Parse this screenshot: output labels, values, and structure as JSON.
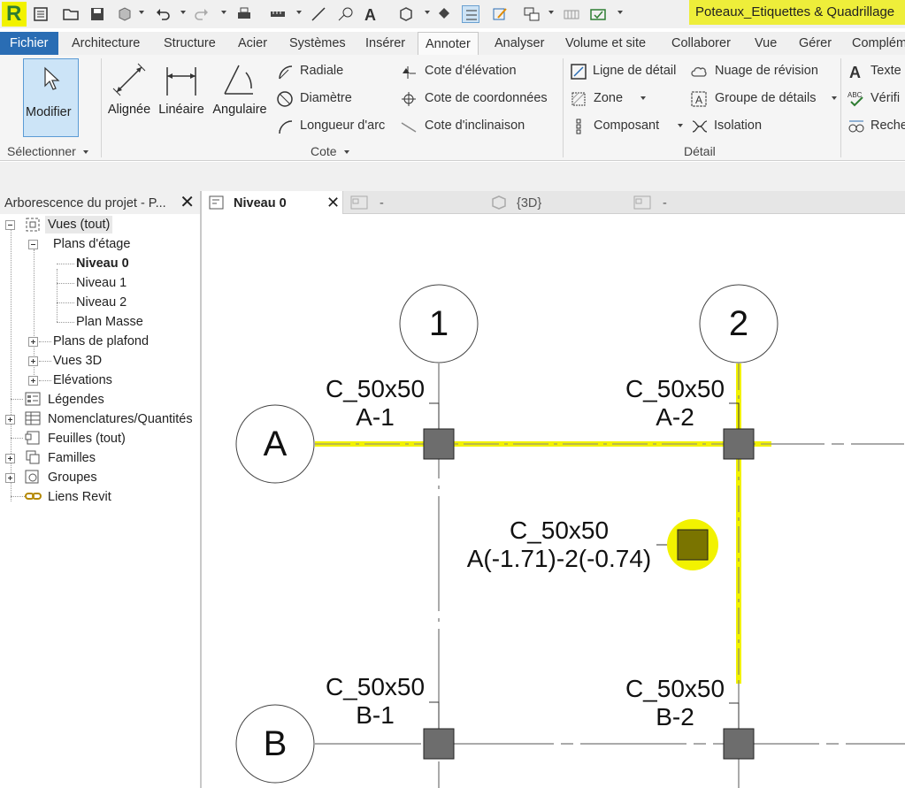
{
  "app": {
    "logo_letter": "R",
    "document_title": "Poteaux_Etiquettes & Quadrillage",
    "highlight_color": "#eeee3a"
  },
  "menu": {
    "file": "Fichier",
    "tabs": [
      "Architecture",
      "Structure",
      "Acier",
      "Systèmes",
      "Insérer",
      "Annoter",
      "Analyser",
      "Volume et site",
      "Collaborer",
      "Vue",
      "Gérer",
      "Complém"
    ],
    "active_tab": "Annoter"
  },
  "ribbon": {
    "select": {
      "modifier": "Modifier",
      "panel": "Sélectionner"
    },
    "cote": {
      "panel": "Cote",
      "big": [
        "Alignée",
        "Linéaire",
        "Angulaire"
      ],
      "col1": [
        "Radiale",
        "Diamètre",
        "Longueur d'arc"
      ],
      "col2": [
        "Cote d'élévation",
        "Cote de coordonnées",
        "Cote d'inclinaison"
      ]
    },
    "detail": {
      "panel": "Détail",
      "col1": [
        "Ligne de détail",
        "Zone",
        "Composant"
      ],
      "col2": [
        "Nuage de révision",
        "Groupe de détails",
        "Isolation"
      ]
    },
    "texte": {
      "items": [
        "Texte",
        "Vérifi",
        "Reche"
      ]
    }
  },
  "browser": {
    "title": "Arborescence du projet - P...",
    "items": {
      "vues": "Vues (tout)",
      "plans": "Plans d'étage",
      "niveau0": "Niveau 0",
      "niveau1": "Niveau 1",
      "niveau2": "Niveau 2",
      "planmasse": "Plan Masse",
      "plafond": "Plans de plafond",
      "vues3d": "Vues 3D",
      "elevations": "Elévations",
      "legendes": "Légendes",
      "nomenclatures": "Nomenclatures/Quantités",
      "feuilles": "Feuilles (tout)",
      "familles": "Familles",
      "groupes": "Groupes",
      "liens": "Liens Revit"
    }
  },
  "view_tabs": {
    "active": "Niveau 0",
    "tab2": "-",
    "tab3": "{3D}",
    "tab4": "-"
  },
  "drawing": {
    "grid_cols": [
      "1",
      "2"
    ],
    "grid_rows": [
      "A",
      "B"
    ],
    "tags": [
      {
        "type": "C_50x50",
        "mark": "A-1"
      },
      {
        "type": "C_50x50",
        "mark": "A-2"
      },
      {
        "type": "C_50x50",
        "mark": "A(-1.71)-2(-0.74)"
      },
      {
        "type": "C_50x50",
        "mark": "B-1"
      },
      {
        "type": "C_50x50",
        "mark": "B-2"
      }
    ],
    "column_color": "#6d6d6d",
    "selected_column_color": "#7a7400",
    "selection_color": "#f2f200"
  }
}
